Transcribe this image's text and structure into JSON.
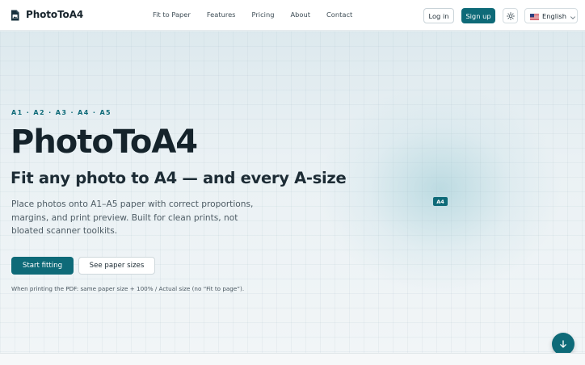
{
  "brand": {
    "name": "PhotoToA4",
    "icon": "document-image-icon"
  },
  "nav": {
    "items": [
      {
        "label": "Fit to Paper"
      },
      {
        "label": "Features"
      },
      {
        "label": "Pricing"
      },
      {
        "label": "About"
      },
      {
        "label": "Contact"
      }
    ]
  },
  "header": {
    "login_label": "Log in",
    "signup_label": "Sign up",
    "theme_icon": "sun-icon",
    "language": {
      "label": "English",
      "flag_icon": "us-flag-icon",
      "dropdown_icon": "chevron-down-icon"
    }
  },
  "hero": {
    "kicker": "A1 · A2 · A3 · A4 · A5",
    "title": "PhotoToA4",
    "subtitle": "Fit any photo to A4 — and every A-size",
    "description": "Place photos onto A1–A5 paper with correct proportions, margins, and print preview. Built for clean prints, not bloated scanner toolkits.",
    "primary_cta": "Start fitting",
    "secondary_cta": "See paper sizes",
    "note": "When printing the PDF: same paper size + 100% / Actual size (no “Fit to page”).",
    "paper_tag": "A4",
    "scroll_icon": "arrow-down-icon"
  },
  "colors": {
    "accent": "#0e6a78",
    "text": "#15232b",
    "muted": "#4d5b64"
  }
}
